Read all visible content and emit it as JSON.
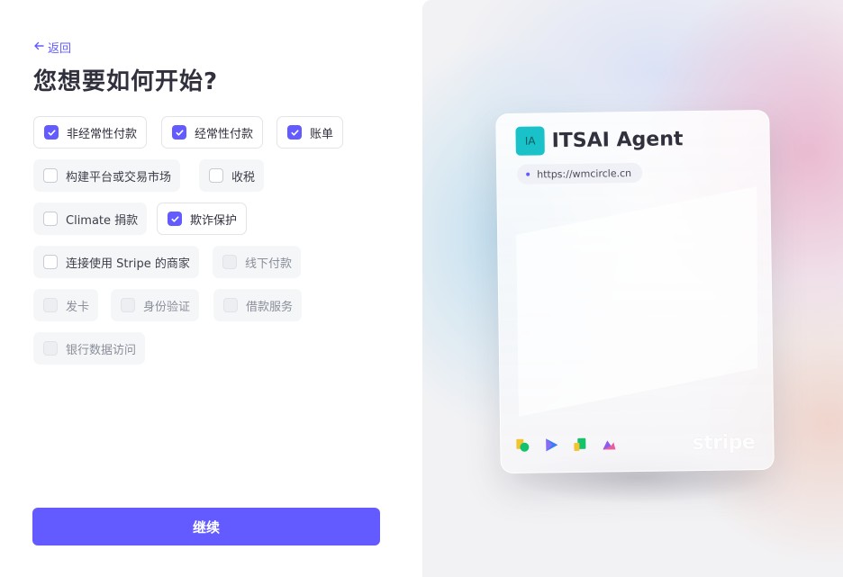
{
  "back": {
    "label": "返回"
  },
  "title": "您想要如何开始?",
  "options": [
    {
      "label": "非经常性付款",
      "state": "checked"
    },
    {
      "label": "经常性付款",
      "state": "checked"
    },
    {
      "label": "账单",
      "state": "checked"
    },
    {
      "label": "构建平台或交易市场",
      "state": "unchecked"
    },
    {
      "label": "收税",
      "state": "unchecked"
    },
    {
      "label": "Climate 捐款",
      "state": "unchecked"
    },
    {
      "label": "欺诈保护",
      "state": "checked"
    },
    {
      "label": "连接使用 Stripe 的商家",
      "state": "unchecked"
    },
    {
      "label": "线下付款",
      "state": "disabled"
    },
    {
      "label": "发卡",
      "state": "disabled"
    },
    {
      "label": "身份验证",
      "state": "disabled"
    },
    {
      "label": "借款服务",
      "state": "disabled"
    },
    {
      "label": "银行数据访问",
      "state": "disabled"
    }
  ],
  "continue_label": "继续",
  "preview": {
    "logo_text": "IA",
    "business_name": "ITSAI Agent",
    "url": "https://wmcircle.cn",
    "brand_word": "stripe",
    "product_icons": [
      "payments-icon",
      "checkout-icon",
      "billing-icon",
      "radar-icon"
    ]
  },
  "colors": {
    "accent": "#635bff",
    "logo_bg": "#18c2c8"
  }
}
